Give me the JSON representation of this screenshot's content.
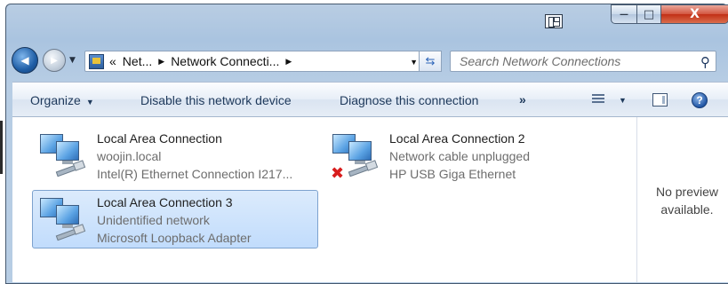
{
  "titlebar": {
    "minimize_glyph": "—",
    "maximize_glyph": "□",
    "close_glyph": "X"
  },
  "nav": {
    "back_glyph": "◀",
    "forward_glyph": "▶",
    "address": {
      "overflow": "«",
      "segments": [
        "Net...",
        "Network Connecti..."
      ],
      "separator": "▶"
    },
    "search_placeholder": "Search Network Connections",
    "search_icon": "magnifier-icon"
  },
  "commandbar": {
    "organize": "Organize",
    "disable": "Disable this network device",
    "diagnose": "Diagnose this connection",
    "more": "»",
    "help_glyph": "?"
  },
  "connections": [
    {
      "name": "Local Area Connection",
      "status": "woojin.local",
      "adapter": "Intel(R) Ethernet Connection I217...",
      "disconnected": false,
      "selected": false
    },
    {
      "name": "Local Area Connection 2",
      "status": "Network cable unplugged",
      "adapter": "HP USB Giga Ethernet",
      "disconnected": true,
      "selected": false
    },
    {
      "name": "Local Area Connection 3",
      "status": "Unidentified network",
      "adapter": "Microsoft Loopback Adapter",
      "disconnected": false,
      "selected": true
    }
  ],
  "preview": {
    "line1": "No preview",
    "line2": "available."
  },
  "colors": {
    "selection": "#c1dcfc",
    "close_button": "#c12f16",
    "command_text": "#1e395b",
    "error_x": "#d81d1d"
  }
}
